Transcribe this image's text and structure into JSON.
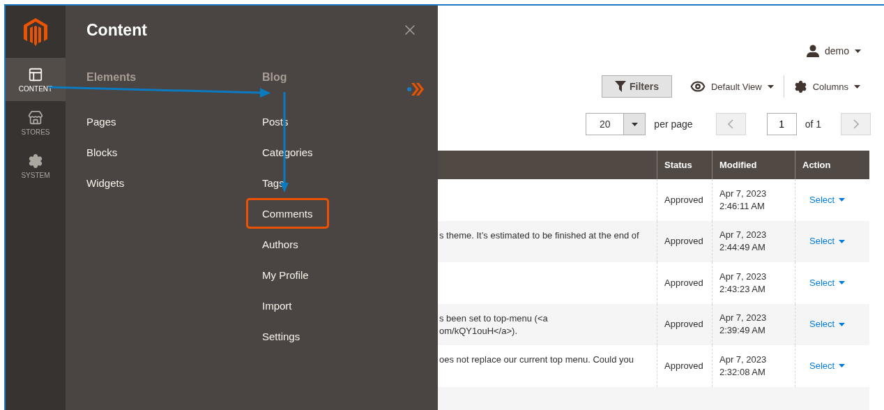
{
  "nav": {
    "items": [
      {
        "label": "CONTENT",
        "kind": "content",
        "selected": true
      },
      {
        "label": "STORES",
        "kind": "stores",
        "selected": false
      },
      {
        "label": "SYSTEM",
        "kind": "system",
        "selected": false
      }
    ]
  },
  "flyout": {
    "title": "Content",
    "columns": [
      {
        "heading": "Elements",
        "items": [
          {
            "label": "Pages",
            "highlighted": false
          },
          {
            "label": "Blocks",
            "highlighted": false
          },
          {
            "label": "Widgets",
            "highlighted": false
          }
        ]
      },
      {
        "heading": "Blog",
        "items": [
          {
            "label": "Posts",
            "highlighted": false
          },
          {
            "label": "Categories",
            "highlighted": false
          },
          {
            "label": "Tags",
            "highlighted": false
          },
          {
            "label": "Comments",
            "highlighted": true
          },
          {
            "label": "Authors",
            "highlighted": false
          },
          {
            "label": "My Profile",
            "highlighted": false
          },
          {
            "label": "Import",
            "highlighted": false
          },
          {
            "label": "Settings",
            "highlighted": false
          }
        ]
      }
    ]
  },
  "user": {
    "name": "demo"
  },
  "toolbar": {
    "filters": "Filters",
    "view": "Default View",
    "columns": "Columns"
  },
  "pager": {
    "per_page": "20",
    "per_page_label": "per page",
    "page": "1",
    "of": "of 1"
  },
  "table": {
    "columns": [
      "Status",
      "Modified",
      "Action"
    ],
    "rows": [
      {
        "status": "Approved",
        "date": "Apr 7, 2023",
        "time": "2:46:11 AM",
        "action": "Select"
      },
      {
        "comment": [
          "s theme. It’s estimated to be finished at the end of"
        ],
        "status": "Approved",
        "date": "Apr 7, 2023",
        "time": "2:44:49 AM",
        "action": "Select"
      },
      {
        "status": "Approved",
        "date": "Apr 7, 2023",
        "time": "2:43:23 AM",
        "action": "Select"
      },
      {
        "comment": [
          "s been set to top-menu (<a",
          "om/kQY1ouH</a>)."
        ],
        "status": "Approved",
        "date": "Apr 7, 2023",
        "time": "2:39:49 AM",
        "action": "Select"
      },
      {
        "comment": [
          "oes not replace our current top menu. Could you"
        ],
        "status": "Approved",
        "date": "Apr 7, 2023",
        "time": "2:32:08 AM",
        "action": "Select"
      }
    ]
  }
}
